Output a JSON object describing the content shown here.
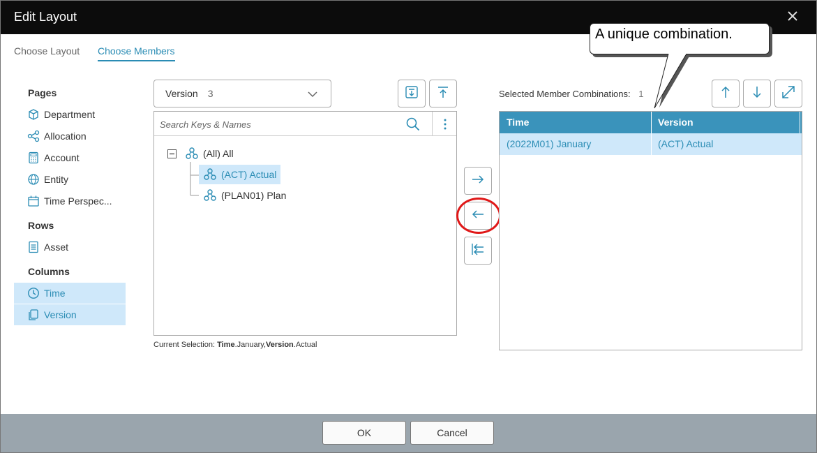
{
  "window": {
    "title": "Edit Layout"
  },
  "tabs": [
    {
      "label": "Choose Layout"
    },
    {
      "label": "Choose Members"
    }
  ],
  "sidebar": {
    "sections": [
      {
        "title": "Pages"
      },
      {
        "title": "Rows"
      },
      {
        "title": "Columns"
      }
    ],
    "items": [
      {
        "label": "Department",
        "icon": "cube-icon"
      },
      {
        "label": "Allocation",
        "icon": "share-nodes-icon"
      },
      {
        "label": "Account",
        "icon": "calculator-icon"
      },
      {
        "label": "Entity",
        "icon": "globe-icon"
      },
      {
        "label": "Time Perspec...",
        "icon": "calendar-icon"
      },
      {
        "label": "Asset",
        "icon": "document-list-icon"
      },
      {
        "label": "Time",
        "icon": "clock-icon"
      },
      {
        "label": "Version",
        "icon": "copy-icon"
      }
    ]
  },
  "dimension_select": {
    "name": "Version",
    "count": "3"
  },
  "search": {
    "placeholder": "Search Keys & Names"
  },
  "tree": [
    {
      "label": "(All) All"
    },
    {
      "label": "(ACT) Actual"
    },
    {
      "label": "(PLAN01) Plan"
    }
  ],
  "current_selection": {
    "prefix": "Current Selection:",
    "dim1": "Time",
    "val1": ".January,",
    "dim2": "Version",
    "val2": ".Actual"
  },
  "combinations": {
    "label": "Selected Member Combinations:",
    "count": "1",
    "columns": [
      "Time",
      "Version"
    ],
    "rows": [
      [
        "(2022M01) January",
        "(ACT) Actual"
      ]
    ]
  },
  "callout": {
    "text": "A unique combination."
  },
  "footer": {
    "ok_label": "OK",
    "cancel_label": "Cancel"
  },
  "colors": {
    "accent": "#2a8cb4",
    "header_blue": "#3a93bb",
    "selection": "#cfe8fa",
    "highlight_ring": "#e01818",
    "footer_bg": "#9aa5ad"
  }
}
